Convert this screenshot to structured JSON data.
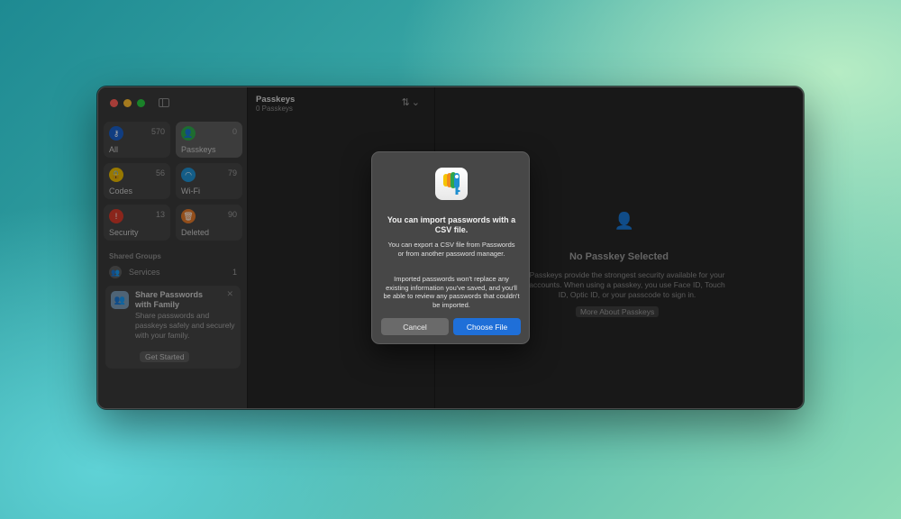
{
  "window": {
    "controls": [
      "close",
      "minimize",
      "zoom"
    ]
  },
  "sidebar": {
    "tiles": [
      {
        "label": "All",
        "count": "570",
        "icon": "key-icon",
        "color": "#1a5fc7"
      },
      {
        "label": "Passkeys",
        "count": "0",
        "icon": "person-key-icon",
        "color": "#2ea64a"
      },
      {
        "label": "Codes",
        "count": "56",
        "icon": "lock-code-icon",
        "color": "#e8b900"
      },
      {
        "label": "Wi-Fi",
        "count": "79",
        "icon": "wifi-icon",
        "color": "#1f8fd0"
      },
      {
        "label": "Security",
        "count": "13",
        "icon": "alert-icon",
        "color": "#d43a2a"
      },
      {
        "label": "Deleted",
        "count": "90",
        "icon": "trash-icon",
        "color": "#e0782a"
      }
    ],
    "section_title": "Shared Groups",
    "group": {
      "label": "Services",
      "count": "1"
    },
    "share_card": {
      "title": "Share Passwords with Family",
      "description": "Share passwords and passkeys safely and securely with your family.",
      "button": "Get Started"
    }
  },
  "list": {
    "title": "Passkeys",
    "subtitle": "0 Passkeys"
  },
  "detail": {
    "title": "No Passkey Selected",
    "description": "Passkeys provide the strongest security available for your accounts. When using a passkey, you use Face ID, Touch ID, Optic ID, or your passcode to sign in.",
    "button": "More About Passkeys"
  },
  "dialog": {
    "title": "You can import passwords with a CSV file.",
    "body1": "You can export a CSV file from Passwords or from another password manager.",
    "body2": "Imported passwords won't replace any existing information you've saved, and you'll be able to review any passwords that couldn't be imported.",
    "cancel": "Cancel",
    "confirm": "Choose File"
  }
}
